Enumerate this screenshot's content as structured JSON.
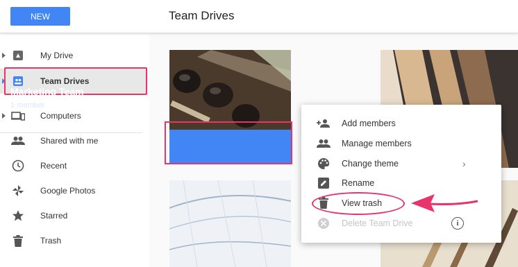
{
  "header": {
    "new_label": "NEW",
    "title": "Team Drives"
  },
  "sidebar": {
    "items": [
      {
        "label": "My Drive",
        "icon": "drive-icon"
      },
      {
        "label": "Team Drives",
        "icon": "team-drive-icon"
      },
      {
        "label": "Computers",
        "icon": "computers-icon"
      },
      {
        "label": "Shared with me",
        "icon": "people-icon"
      },
      {
        "label": "Recent",
        "icon": "clock-icon"
      },
      {
        "label": "Google Photos",
        "icon": "pinwheel-icon"
      },
      {
        "label": "Starred",
        "icon": "star-icon"
      },
      {
        "label": "Trash",
        "icon": "trash-icon"
      }
    ]
  },
  "cards": [
    {
      "name": "Marketing Team",
      "members": "1 member",
      "color": "#4285f4"
    }
  ],
  "context_menu": {
    "items": [
      {
        "label": "Add members",
        "icon": "person-add-icon"
      },
      {
        "label": "Manage members",
        "icon": "people-icon"
      },
      {
        "label": "Change theme",
        "icon": "palette-icon"
      },
      {
        "label": "Rename",
        "icon": "edit-icon"
      },
      {
        "label": "View trash",
        "icon": "trash-icon"
      },
      {
        "label": "Delete Team Drive",
        "icon": "delete-x-icon",
        "disabled": true
      }
    ]
  },
  "colors": {
    "accent": "#4285f4",
    "annotation": "#e8336b"
  }
}
